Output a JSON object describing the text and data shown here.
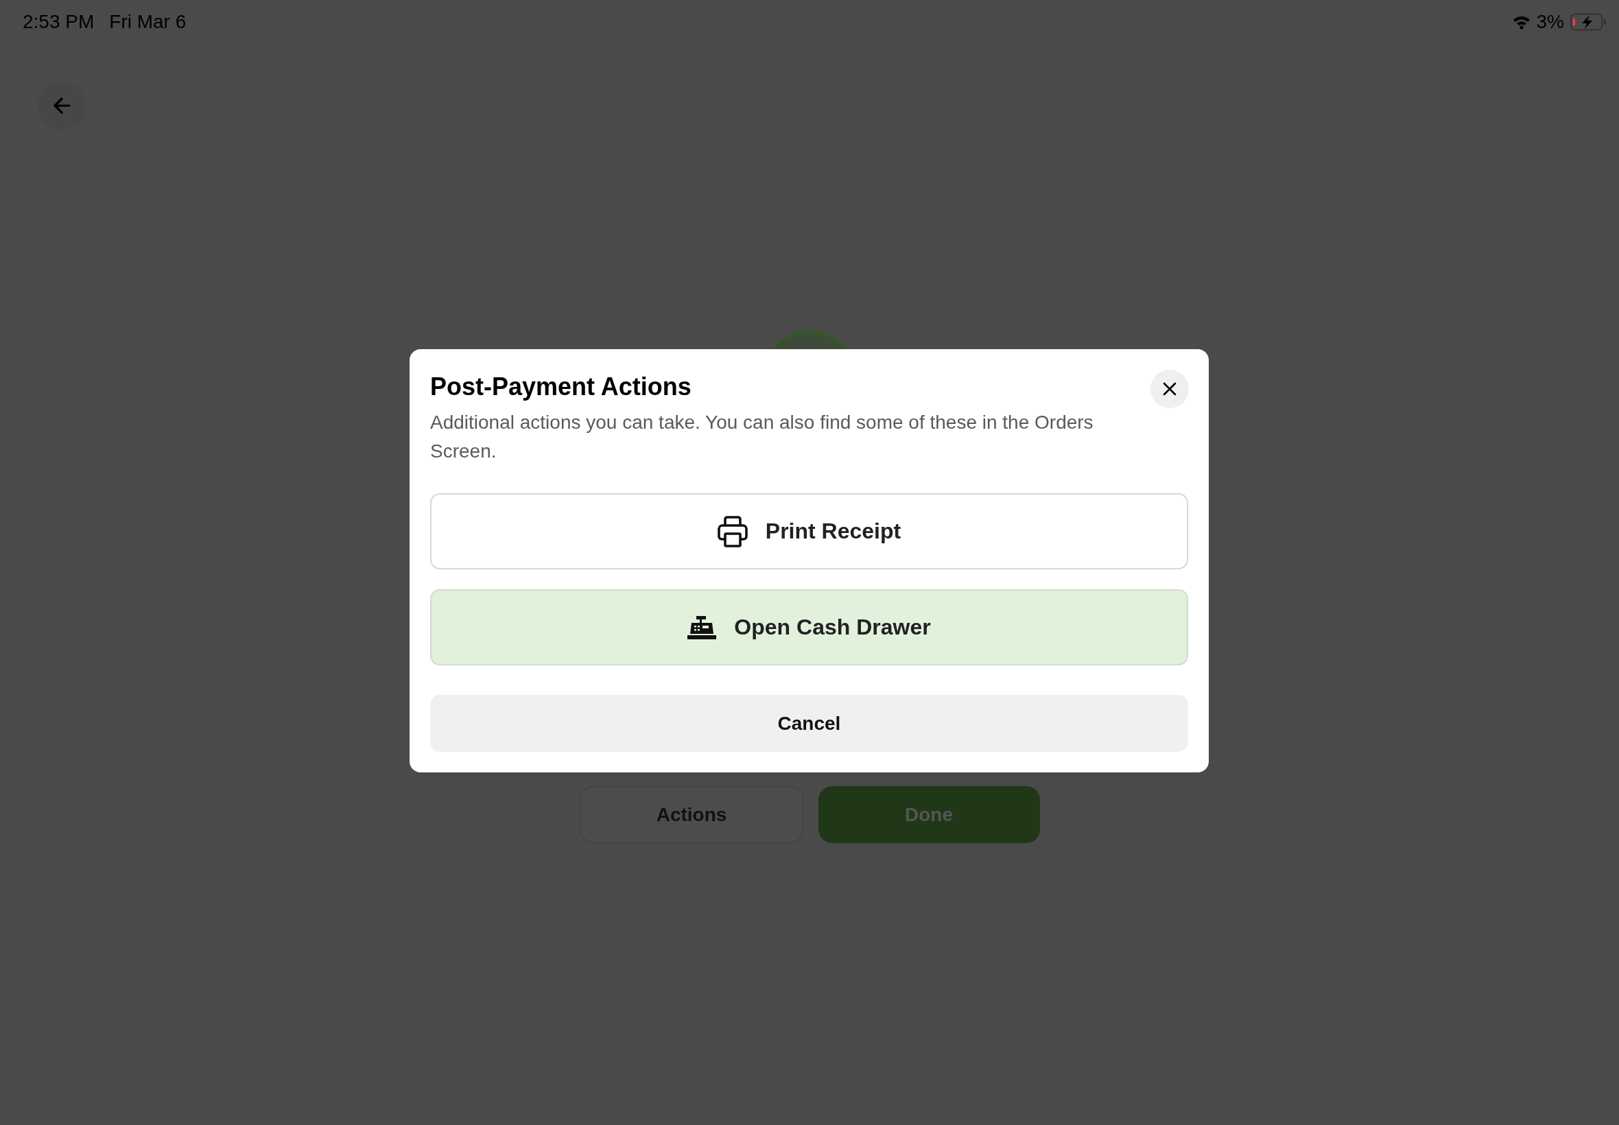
{
  "status_bar": {
    "time": "2:53 PM",
    "date": "Fri Mar 6",
    "battery": "3%"
  },
  "background": {
    "buttons": [
      {
        "label": "Actions",
        "kind": "secondary"
      },
      {
        "label": "Done",
        "kind": "primary"
      }
    ]
  },
  "dialog": {
    "title": "Post-Payment Actions",
    "description": "Additional actions you can take. You can also find some of these in the Orders Screen.",
    "actions": [
      {
        "label": "Print Receipt",
        "kind": "print"
      },
      {
        "label": "Open Cash Drawer",
        "kind": "drawer"
      }
    ],
    "cancel": "Cancel"
  }
}
